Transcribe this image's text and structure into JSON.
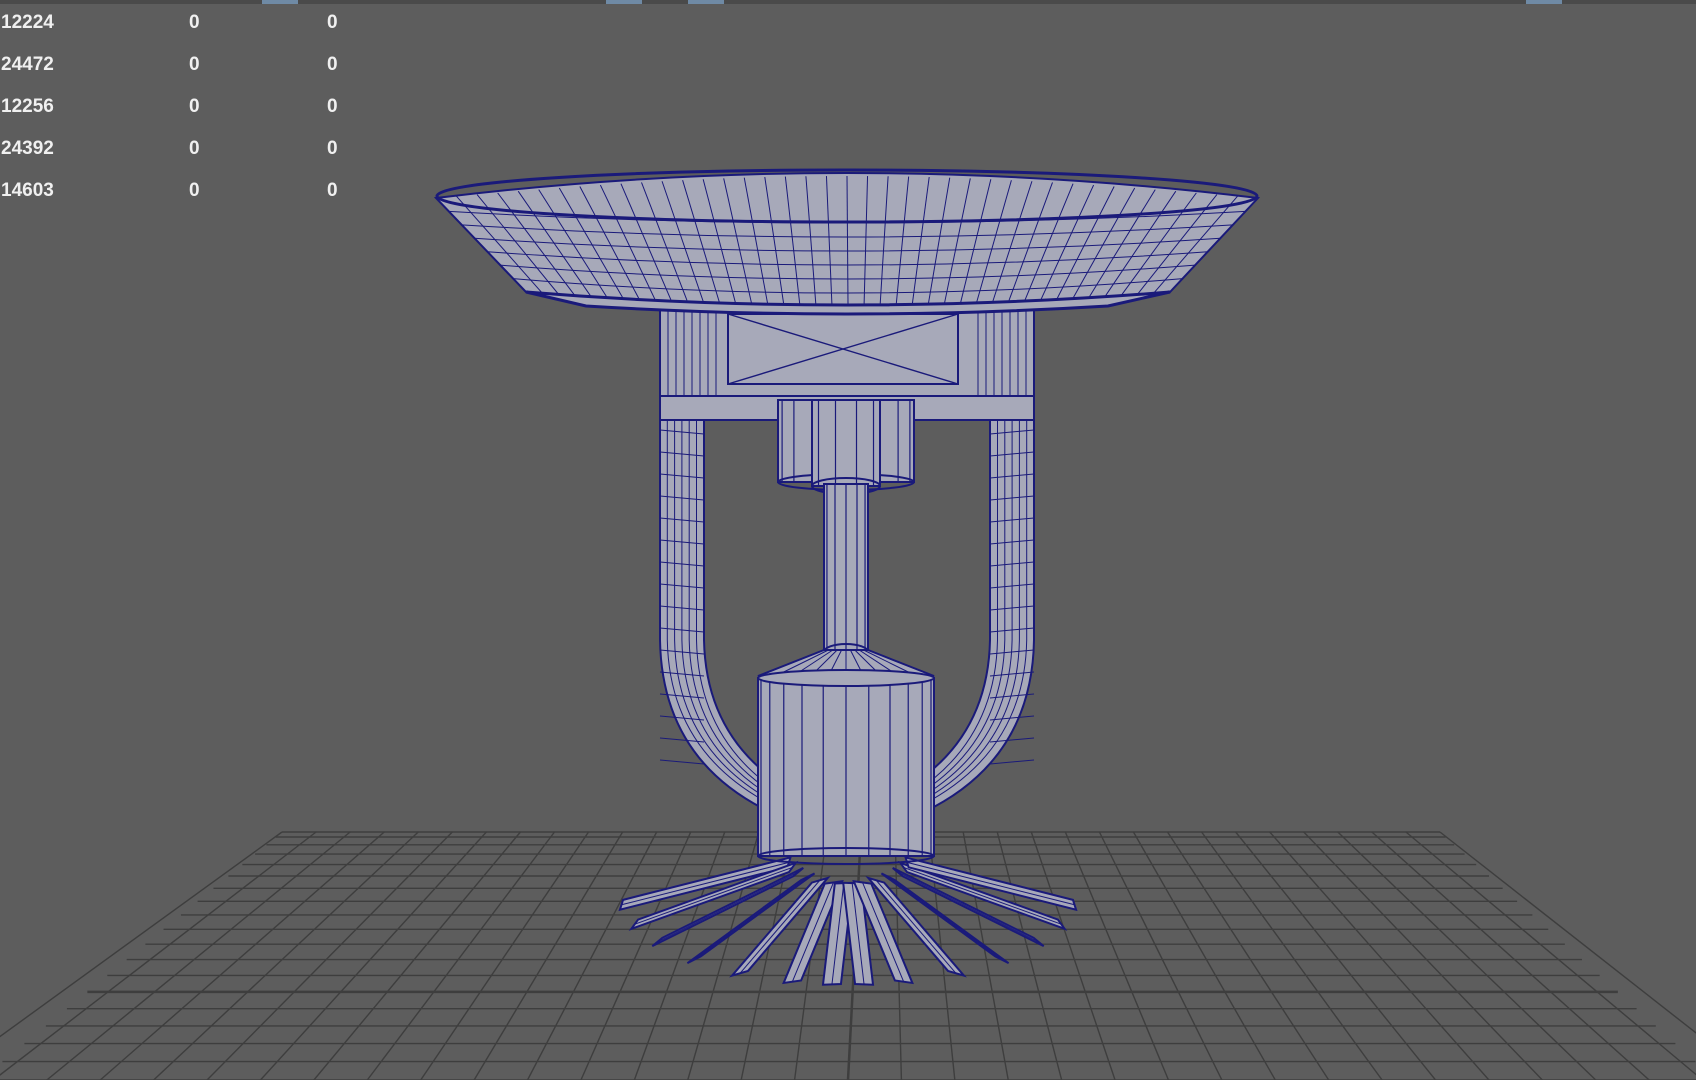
{
  "viewport": {
    "name": "3d-viewport",
    "background": "#5d5d5d",
    "wire_color": "#1a1a7a",
    "mesh_fill": "#a7a9b9",
    "grid_color": "#3e3e3e"
  },
  "poly_count_hud": {
    "rows": [
      {
        "value": "12224",
        "col2": "0",
        "col3": "0"
      },
      {
        "value": "24472",
        "col2": "0",
        "col3": "0"
      },
      {
        "value": "12256",
        "col2": "0",
        "col3": "0"
      },
      {
        "value": "24392",
        "col2": "0",
        "col3": "0"
      },
      {
        "value": "14603",
        "col2": "0",
        "col3": "0"
      }
    ]
  }
}
